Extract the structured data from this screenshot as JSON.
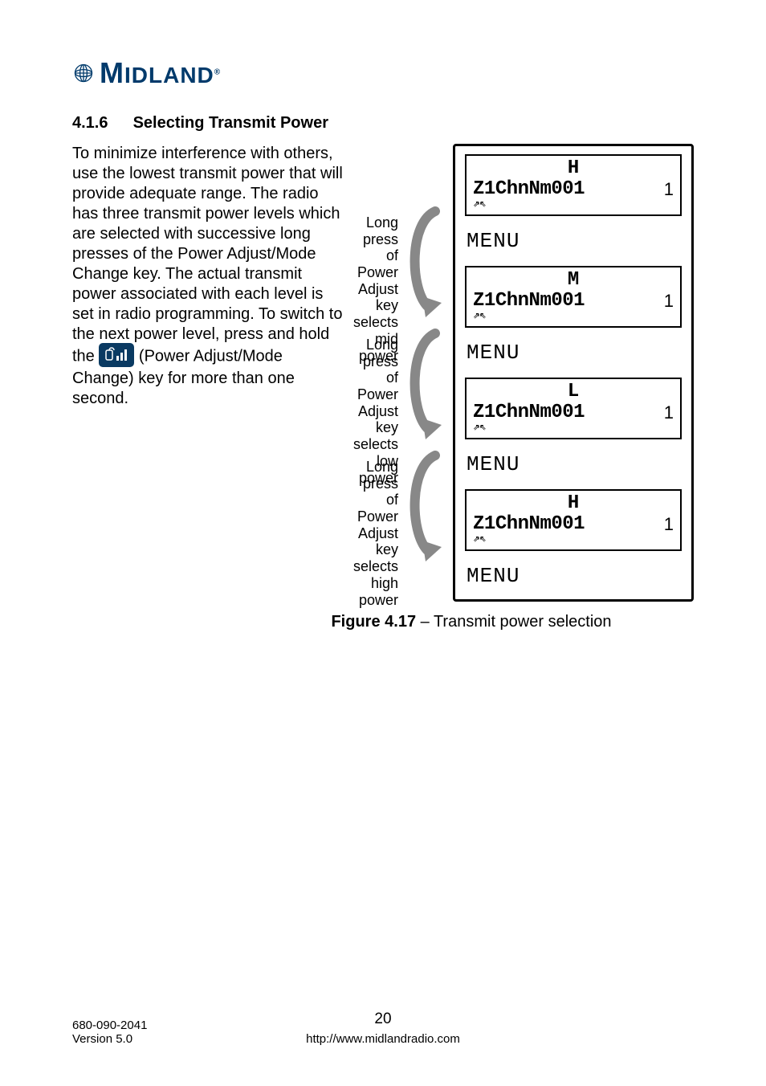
{
  "logo": {
    "brand": "MIDLAND"
  },
  "section": {
    "number": "4.1.6",
    "title": "Selecting Transmit Power"
  },
  "body": {
    "p1a": "To minimize interference with others, use the lowest transmit power that will provide adequate range. The radio has three transmit power levels which are selected with successive long presses of the Power Adjust/Mode Change key. The actual transmit power associated with each level is set in radio programming. To switch to the next power level, press and hold",
    "p1b_pre": "the ",
    "p1b_post": " (Power Adjust/Mode Change) key for more than one second."
  },
  "labels": [
    "Long press of Power Adjust key selects mid power",
    "Long press of Power Adjust key selects low power",
    "Long press of Power Adjust key selects high power"
  ],
  "screens": [
    {
      "top": "H",
      "main": "Z1ChnNm001",
      "side": "1",
      "menu": "MENU"
    },
    {
      "top": "M",
      "main": "Z1ChnNm001",
      "side": "1",
      "menu": "MENU"
    },
    {
      "top": "L",
      "main": "Z1ChnNm001",
      "side": "1",
      "menu": "MENU"
    },
    {
      "top": "H",
      "main": "Z1ChnNm001",
      "side": "1",
      "menu": "MENU"
    }
  ],
  "caption": {
    "bold": "Figure 4.17",
    "rest": " – Transmit power selection"
  },
  "footer": {
    "doc": "680-090-2041",
    "version": "Version 5.0",
    "page": "20",
    "url": "http://www.midlandradio.com"
  }
}
